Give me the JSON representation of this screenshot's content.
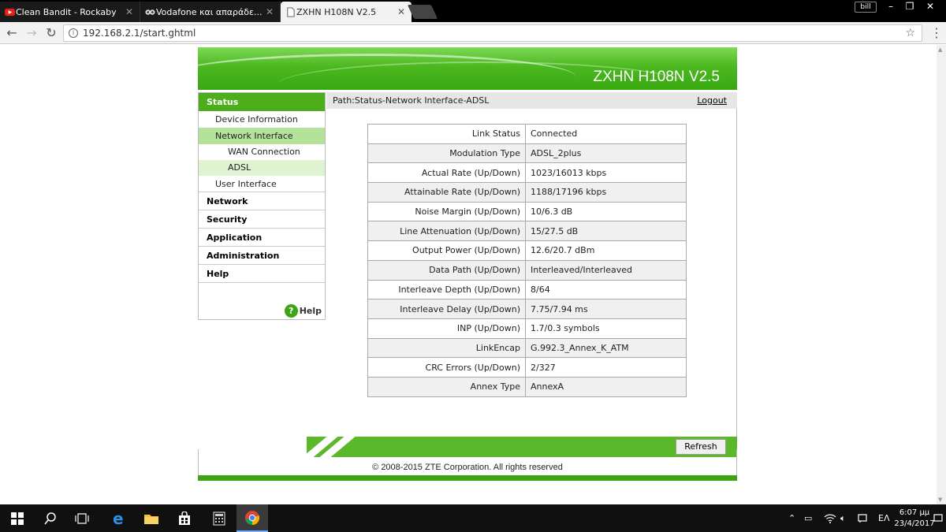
{
  "browser": {
    "tabs": [
      {
        "label": "Clean Bandit - Rockaby",
        "icon": "youtube-icon",
        "active": false
      },
      {
        "label": "Vodafone και απαράδε...",
        "icon": "vodafone-icon",
        "active": false
      },
      {
        "label": "ZXHN H108N V2.5",
        "icon": "page-icon",
        "active": true
      }
    ],
    "tab_close": "✕",
    "profile": "bill",
    "url": "192.168.2.1/start.ghtml"
  },
  "router": {
    "model": "ZXHN H108N V2.5",
    "path": "Path:Status-Network Interface-ADSL",
    "logout": "Logout",
    "nav": [
      {
        "label": "Status"
      },
      {
        "label": "Device Information"
      },
      {
        "label": "Network Interface"
      },
      {
        "label": "WAN Connection"
      },
      {
        "label": "ADSL"
      },
      {
        "label": "User Interface"
      },
      {
        "label": "Network"
      },
      {
        "label": "Security"
      },
      {
        "label": "Application"
      },
      {
        "label": "Administration"
      },
      {
        "label": "Help"
      }
    ],
    "help_label": "Help",
    "rows": [
      {
        "label": "Link Status",
        "value": "Connected"
      },
      {
        "label": "Modulation Type",
        "value": "ADSL_2plus"
      },
      {
        "label": "Actual Rate (Up/Down)",
        "value": "1023/16013 kbps"
      },
      {
        "label": "Attainable Rate (Up/Down)",
        "value": "1188/17196 kbps"
      },
      {
        "label": "Noise Margin (Up/Down)",
        "value": "10/6.3 dB"
      },
      {
        "label": "Line Attenuation (Up/Down)",
        "value": "15/27.5 dB"
      },
      {
        "label": "Output Power (Up/Down)",
        "value": "12.6/20.7 dBm"
      },
      {
        "label": "Data Path (Up/Down)",
        "value": "Interleaved/Interleaved"
      },
      {
        "label": "Interleave Depth (Up/Down)",
        "value": "8/64"
      },
      {
        "label": "Interleave Delay (Up/Down)",
        "value": "7.75/7.94 ms"
      },
      {
        "label": "INP (Up/Down)",
        "value": "1.7/0.3 symbols"
      },
      {
        "label": "LinkEncap",
        "value": "G.992.3_Annex_K_ATM"
      },
      {
        "label": "CRC Errors (Up/Down)",
        "value": "2/327"
      },
      {
        "label": "Annex Type",
        "value": "AnnexA"
      }
    ],
    "refresh": "Refresh",
    "copyright": "© 2008-2015 ZTE Corporation. All rights reserved"
  },
  "taskbar": {
    "language": "ΕΛ",
    "time": "6:07 μμ",
    "date": "23/4/2017"
  },
  "colors": {
    "accent_green": "#4cae1a",
    "selected_nav": "#b5e29a",
    "selected_subnav": "#dff3d3"
  }
}
